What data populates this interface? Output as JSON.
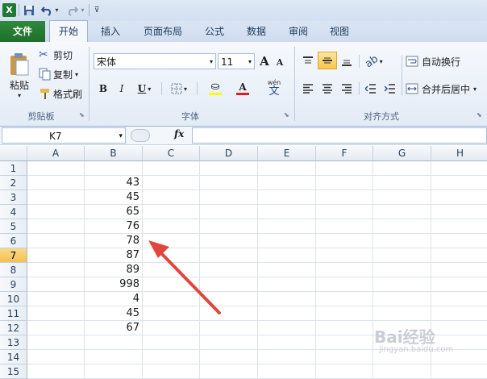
{
  "qat": {
    "excel_icon": "excel-icon",
    "save_icon": "save-icon",
    "undo_icon": "undo-icon",
    "redo_icon": "redo-icon"
  },
  "tabs": [
    {
      "label": "文件"
    },
    {
      "label": "开始"
    },
    {
      "label": "插入"
    },
    {
      "label": "页面布局"
    },
    {
      "label": "公式"
    },
    {
      "label": "数据"
    },
    {
      "label": "审阅"
    },
    {
      "label": "视图"
    }
  ],
  "clipboard": {
    "paste": "粘贴",
    "cut": "剪切",
    "copy": "复制",
    "format_painter": "格式刷",
    "group_label": "剪贴板"
  },
  "font": {
    "name": "宋体",
    "size": "11",
    "bold": "B",
    "italic": "I",
    "underline": "U",
    "text_color_glyph": "A",
    "wen": "wén",
    "wen_char": "文",
    "grow_glyph": "A",
    "shrink_glyph": "A",
    "group_label": "字体"
  },
  "alignment": {
    "wrap_text": "自动换行",
    "merge_center": "合并后居中",
    "group_label": "对齐方式"
  },
  "formula_bar": {
    "name_box": "K7",
    "fx": "fx",
    "formula": ""
  },
  "sheet": {
    "columns": [
      "A",
      "B",
      "C",
      "D",
      "E",
      "F",
      "G",
      "H"
    ],
    "rows": [
      {
        "num": "1",
        "b": ""
      },
      {
        "num": "2",
        "b": "43"
      },
      {
        "num": "3",
        "b": "45"
      },
      {
        "num": "4",
        "b": "65"
      },
      {
        "num": "5",
        "b": "76"
      },
      {
        "num": "6",
        "b": "78"
      },
      {
        "num": "7",
        "b": "87"
      },
      {
        "num": "8",
        "b": "89"
      },
      {
        "num": "9",
        "b": "998"
      },
      {
        "num": "10",
        "b": "4"
      },
      {
        "num": "11",
        "b": "45"
      },
      {
        "num": "12",
        "b": "67"
      },
      {
        "num": "13",
        "b": ""
      },
      {
        "num": "14",
        "b": ""
      },
      {
        "num": "15",
        "b": ""
      }
    ],
    "selected_row": "7"
  },
  "watermark": {
    "text": "Bai经验",
    "url": "jingyan.baidu.com"
  },
  "colors": {
    "file_tab": "#2a7d36",
    "arrow": "#e0463e",
    "selected_row": "#f3c14f"
  }
}
